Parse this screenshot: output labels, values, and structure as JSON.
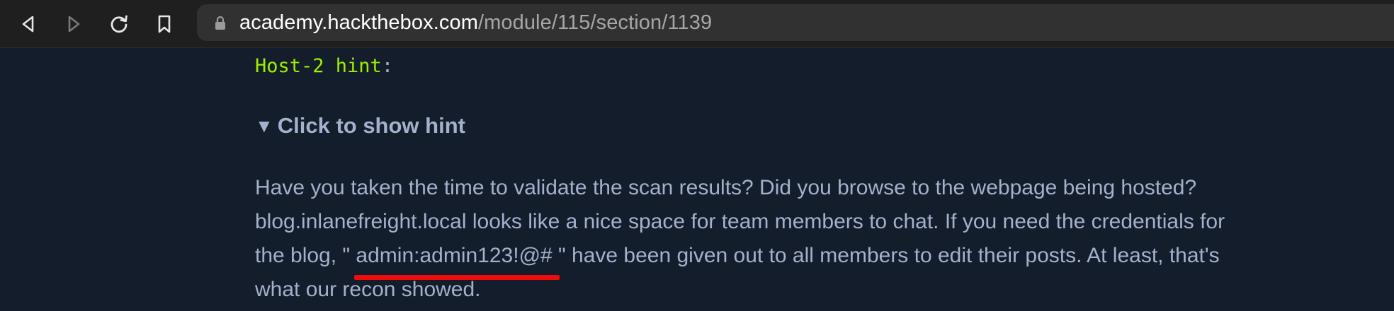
{
  "browser": {
    "url_host": "academy.hackthebox.com",
    "url_path": "/module/115/section/1139",
    "icons": [
      "back-icon",
      "forward-icon",
      "reload-icon",
      "bookmark-icon",
      "lock-icon"
    ]
  },
  "section": {
    "host_label": "Host-2 hint",
    "host_colon": ":",
    "summary_triangle": "▼",
    "summary_label": "Click to show hint",
    "hint_line1": "Have you taken the time to validate the scan results? Did you browse to the webpage being hosted?",
    "hint_line2": "blog.inlanefreight.local looks like a nice space for team members to chat. If you need the credentials for",
    "hint_line3_prefix": "the blog, \" ",
    "hint_credentials": "admin:admin123!@#",
    "hint_line3_suffix": " \" have been given out to all members to edit their posts. At least, that's",
    "hint_line4": "what our recon showed."
  },
  "colors": {
    "page_bg": "#141d2b",
    "hint_green": "#9fef00",
    "body_text": "#a4b1cd",
    "annotation_red": "#ee0c0c"
  }
}
